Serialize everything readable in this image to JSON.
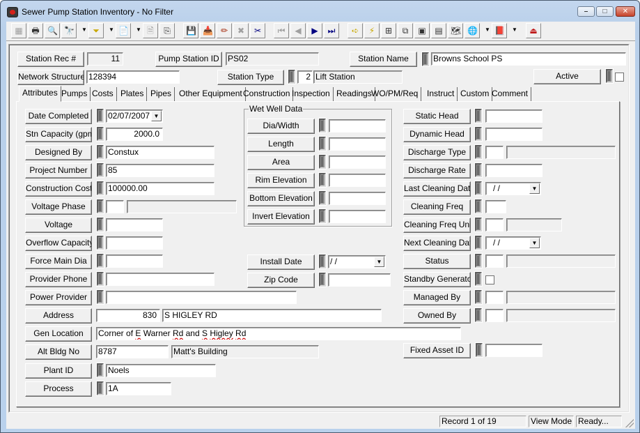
{
  "window": {
    "title": "Sewer Pump Station Inventory - No Filter",
    "controls": {
      "minimize": "–",
      "maximize": "□",
      "close": "✕"
    }
  },
  "toolbar": {
    "buttons": [
      {
        "name": "form-view-icon",
        "glyph": "▦",
        "enabled": false
      },
      {
        "name": "print-icon",
        "glyph": "🖶",
        "enabled": true
      },
      {
        "name": "print-preview-icon",
        "glyph": "🔍",
        "enabled": true
      },
      {
        "name": "find-icon",
        "glyph": "🔭",
        "enabled": true,
        "dropdown": true
      },
      {
        "name": "filter-icon",
        "glyph": "⏷",
        "enabled": true,
        "dropdown": true
      },
      {
        "name": "report-icon",
        "glyph": "📄",
        "enabled": true,
        "dropdown": true
      },
      {
        "name": "properties-icon",
        "glyph": "🗎",
        "enabled": false
      },
      {
        "name": "export-icon",
        "glyph": "⎘",
        "enabled": true
      },
      {
        "name": "save-icon",
        "glyph": "💾",
        "enabled": false
      },
      {
        "name": "add-record-icon",
        "glyph": "📥",
        "enabled": true
      },
      {
        "name": "edit-pencil-icon",
        "glyph": "✏",
        "enabled": true
      },
      {
        "name": "delete-x-icon",
        "glyph": "✖",
        "enabled": false
      },
      {
        "name": "cut-scissors-icon",
        "glyph": "✂",
        "enabled": true
      },
      {
        "name": "first-record-icon",
        "glyph": "⏮",
        "enabled": false
      },
      {
        "name": "previous-record-icon",
        "glyph": "◀",
        "enabled": false
      },
      {
        "name": "next-record-icon",
        "glyph": "▶",
        "enabled": true
      },
      {
        "name": "last-record-icon",
        "glyph": "⏭",
        "enabled": true
      },
      {
        "name": "goto-arrow-icon",
        "glyph": "➪",
        "enabled": true
      },
      {
        "name": "lightning-icon",
        "glyph": "⚡",
        "enabled": true
      },
      {
        "name": "network-map-icon",
        "glyph": "⊞",
        "enabled": true
      },
      {
        "name": "flow-diagram-icon",
        "glyph": "⧉",
        "enabled": true
      },
      {
        "name": "equipment-icon",
        "glyph": "▣",
        "enabled": true
      },
      {
        "name": "calculator-icon",
        "glyph": "▤",
        "enabled": true
      },
      {
        "name": "gis-map-icon",
        "glyph": "🗺",
        "enabled": true
      },
      {
        "name": "globe-search-icon",
        "glyph": "🌐",
        "enabled": true,
        "dropdown": true
      },
      {
        "name": "help-book-icon",
        "glyph": "📕",
        "enabled": true,
        "dropdown": true
      },
      {
        "name": "exit-icon",
        "glyph": "⏏",
        "enabled": true
      }
    ],
    "dropdown_glyph": "▼"
  },
  "header": {
    "station_rec": {
      "label": "Station Rec #",
      "value": "11"
    },
    "pump_station_id": {
      "label": "Pump Station ID",
      "value": "PS02"
    },
    "station_name": {
      "label": "Station Name",
      "value": "Browns School PS"
    },
    "network_structure": {
      "label": "Network Structure",
      "value": "128394"
    },
    "station_type": {
      "label": "Station Type",
      "code": "2",
      "description": "Lift Station"
    },
    "active": {
      "label": "Active",
      "checked": false
    }
  },
  "tabs": [
    {
      "label": "Attributes",
      "active": true
    },
    {
      "label": "Pumps"
    },
    {
      "label": "Costs"
    },
    {
      "label": "Plates"
    },
    {
      "label": "Pipes"
    },
    {
      "label": "Other Equipment"
    },
    {
      "label": "Construction"
    },
    {
      "label": "Inspection"
    },
    {
      "label": "Readings"
    },
    {
      "label": "WO/PM/Req"
    },
    {
      "label": "Instruct"
    },
    {
      "label": "Custom"
    },
    {
      "label": "Comment"
    }
  ],
  "attributes": {
    "left": [
      {
        "label": "Date Completed",
        "value": "02/07/2007",
        "type": "date"
      },
      {
        "label": "Stn Capacity (gpm)",
        "value": "2000.0",
        "type": "number"
      },
      {
        "label": "Designed By",
        "value": "Constux"
      },
      {
        "label": "Project Number",
        "value": "85"
      },
      {
        "label": "Construction Cost",
        "value": "100000.00"
      },
      {
        "label": "Voltage Phase",
        "value": "",
        "description": ""
      },
      {
        "label": "Voltage",
        "value": ""
      },
      {
        "label": "Overflow Capacity",
        "value": ""
      },
      {
        "label": "Force Main Dia",
        "value": ""
      },
      {
        "label": "Provider Phone",
        "value": ""
      },
      {
        "label": "Power Provider",
        "value": ""
      }
    ],
    "address": {
      "label": "Address",
      "number": "830",
      "street": "S HIGLEY RD"
    },
    "gen_location": {
      "label": "Gen Location",
      "value_parts": [
        "Corner of ",
        "E",
        " Warner ",
        "Rd",
        " and ",
        "S",
        " ",
        "Higley",
        " ",
        "Rd"
      ]
    },
    "alt_bldg": {
      "label": "Alt Bldg No",
      "number": "8787",
      "name": "Matt's Building"
    },
    "plant_id": {
      "label": "Plant ID",
      "value": "Noels"
    },
    "process": {
      "label": "Process",
      "value": "1A"
    },
    "wet_well": {
      "title": "Wet Well Data",
      "fields": [
        {
          "label": "Dia/Width",
          "value": ""
        },
        {
          "label": "Length",
          "value": ""
        },
        {
          "label": "Area",
          "value": ""
        },
        {
          "label": "Rim Elevation",
          "value": ""
        },
        {
          "label": "Bottom Elevation",
          "value": ""
        },
        {
          "label": "Invert Elevation",
          "value": ""
        }
      ]
    },
    "install_date": {
      "label": "Install Date",
      "value": " /  /"
    },
    "zip_code": {
      "label": "Zip Code",
      "value": ""
    },
    "right": [
      {
        "label": "Static Head",
        "value": ""
      },
      {
        "label": "Dynamic Head",
        "value": ""
      },
      {
        "label": "Discharge Type",
        "value": "",
        "description": ""
      },
      {
        "label": "Discharge Rate",
        "value": ""
      },
      {
        "label": "Last Cleaning Date",
        "value": " /  /"
      },
      {
        "label": "Cleaning Freq",
        "value": ""
      },
      {
        "label": "Cleaning Freq Units",
        "value": "",
        "description": ""
      },
      {
        "label": "Next Cleaning Date",
        "value": " /  /"
      },
      {
        "label": "Status",
        "value": "",
        "description": ""
      },
      {
        "label": "Standby Generator",
        "checked": false
      },
      {
        "label": "Managed By",
        "value": "",
        "description": ""
      },
      {
        "label": "Owned By",
        "value": "",
        "description": ""
      }
    ],
    "fixed_asset_id": {
      "label": "Fixed Asset ID",
      "value": ""
    }
  },
  "statusbar": {
    "record": "Record 1 of 19",
    "mode": "View Mode",
    "state": "Ready..."
  }
}
